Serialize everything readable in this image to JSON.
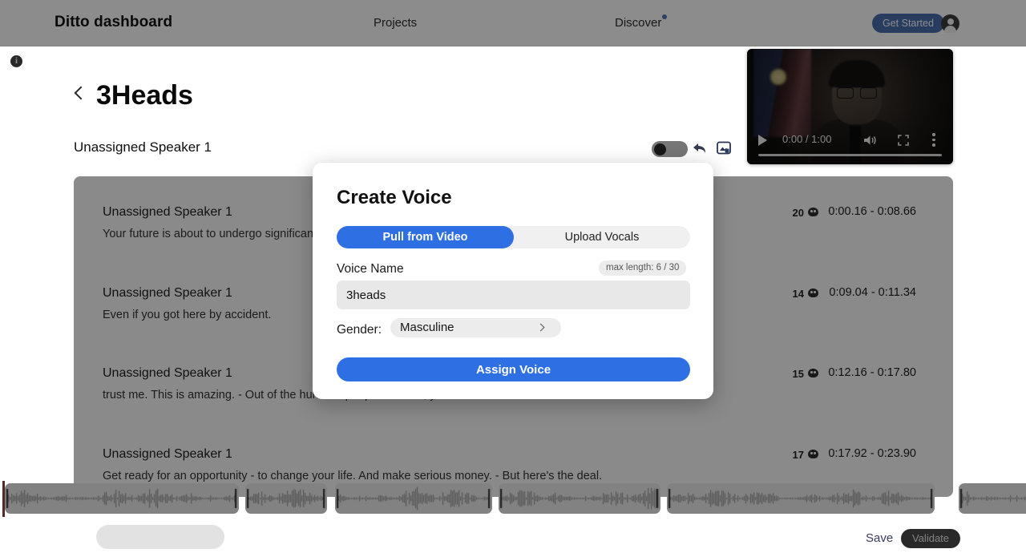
{
  "topnav": {
    "brand": "Ditto dashboard",
    "projects": "Projects",
    "discover": "Discover",
    "get_started": "Get Started",
    "accent_blue": "#2f6fe4"
  },
  "project": {
    "title": "3Heads",
    "speaker_header": "Unassigned Speaker 1"
  },
  "video": {
    "current_time": "0:00",
    "duration": "1:00",
    "time_display": "0:00 / 1:00"
  },
  "segments": [
    {
      "speaker": "Unassigned Speaker 1",
      "text": "Your future is about to undergo significant changes, and what I'm about to share with you today will change your life.",
      "count": "20",
      "time": "0:00.16 - 0:08.66"
    },
    {
      "speaker": "Unassigned Speaker 1",
      "text": "Even if you got here by accident.",
      "count": "14",
      "time": "0:09.04 - 0:11.34"
    },
    {
      "speaker": "Unassigned Speaker 1",
      "text": "trust me. This is amazing. - Out of the hundred people I invited, you're one of them.",
      "count": "15",
      "time": "0:12.16 - 0:17.80"
    },
    {
      "speaker": "Unassigned Speaker 1",
      "text": "Get ready for an opportunity - to change your life. And make serious money. - But here's the deal.",
      "count": "17",
      "time": "0:17.92 - 0:23.90"
    }
  ],
  "actions": {
    "save": "Save",
    "validate": "Validate"
  },
  "modal": {
    "title": "Create Voice",
    "tab_pull": "Pull from Video",
    "tab_upload": "Upload Vocals",
    "voice_name_label": "Voice Name",
    "max_length_badge": "max length: 6 / 30",
    "voice_name_value": "3heads",
    "voice_name_placeholder": "Voice Name",
    "gender_label": "Gender:",
    "gender_value": "Masculine",
    "assign_button": "Assign Voice"
  }
}
